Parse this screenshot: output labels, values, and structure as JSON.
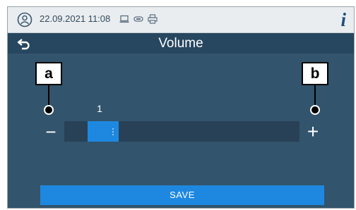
{
  "status_bar": {
    "datetime": "22.09.2021 11:08",
    "icons": [
      "user-circle-icon",
      "laptop-icon",
      "usb-icon",
      "printer-icon"
    ],
    "info_label": "i"
  },
  "header": {
    "title": "Volume",
    "back_icon": "back-arrow-icon"
  },
  "volume_control": {
    "value": "1",
    "minus_label": "−",
    "plus_label": "+",
    "level_fraction": 0.1
  },
  "footer": {
    "save_label": "SAVE"
  },
  "callouts": {
    "a": "a",
    "b": "b"
  },
  "colors": {
    "background": "#32546c",
    "titlebar": "#274760",
    "accent": "#1e88e0",
    "statusbar": "#e9edf0"
  }
}
